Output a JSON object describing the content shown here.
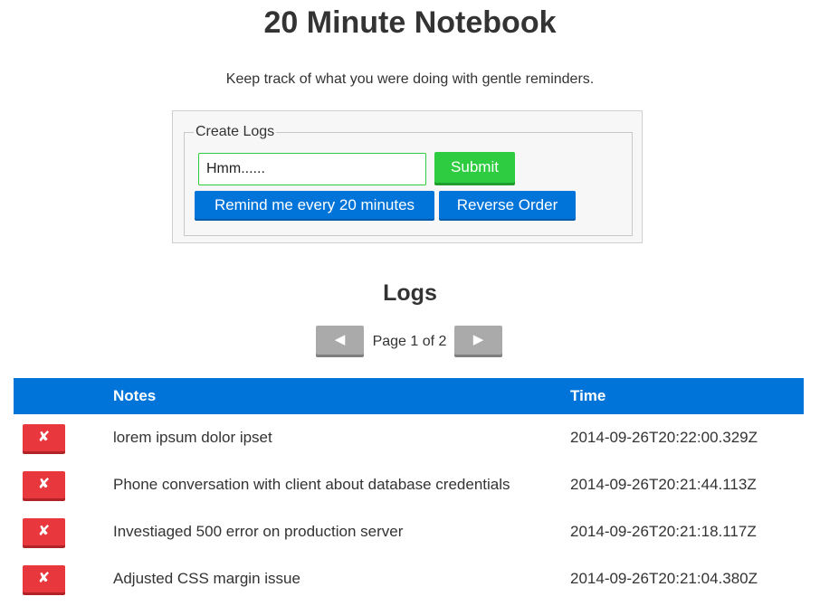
{
  "header": {
    "title": "20 Minute Notebook",
    "tagline": "Keep track of what you were doing with gentle reminders."
  },
  "create": {
    "legend": "Create Logs",
    "input_value": "Hmm......",
    "submit_label": "Submit",
    "remind_label": "Remind me every 20 minutes",
    "reverse_label": "Reverse Order"
  },
  "logs": {
    "heading": "Logs",
    "pager": {
      "prev_icon": "◀",
      "next_icon": "▶",
      "text": "Page 1 of 2"
    },
    "columns": {
      "delete": "",
      "notes": "Notes",
      "time": "Time"
    },
    "delete_icon": "✘",
    "rows": [
      {
        "note": "lorem ipsum dolor ipset",
        "time": "2014-09-26T20:22:00.329Z"
      },
      {
        "note": "Phone conversation with client about database credentials",
        "time": "2014-09-26T20:21:44.113Z"
      },
      {
        "note": "Investiaged 500 error on production server",
        "time": "2014-09-26T20:21:18.117Z"
      },
      {
        "note": "Adjusted CSS margin issue",
        "time": "2014-09-26T20:21:04.380Z"
      }
    ]
  },
  "colors": {
    "primary": "#0074d9",
    "success": "#2ecc40",
    "danger": "#e8383d",
    "neutral": "#aaaaaa"
  }
}
